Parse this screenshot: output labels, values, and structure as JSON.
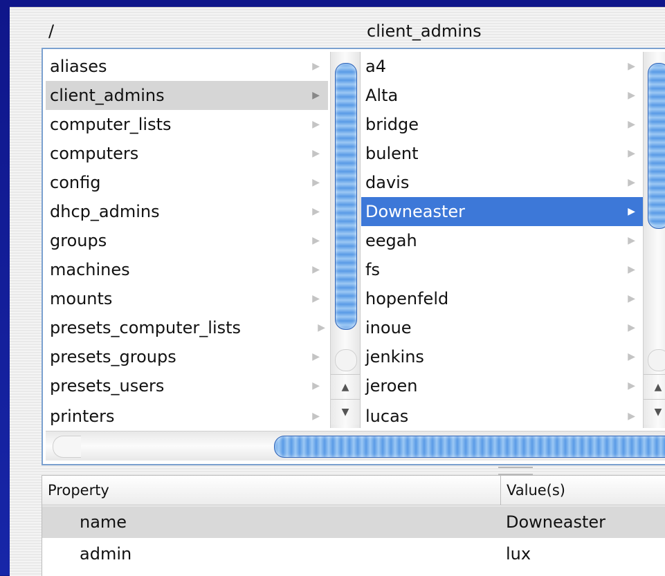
{
  "path_header": "/",
  "column_header": "client_admins",
  "column1": {
    "items": [
      {
        "label": "aliases"
      },
      {
        "label": "client_admins",
        "selected": "inactive"
      },
      {
        "label": "computer_lists"
      },
      {
        "label": "computers"
      },
      {
        "label": "config"
      },
      {
        "label": "dhcp_admins"
      },
      {
        "label": "groups"
      },
      {
        "label": "machines"
      },
      {
        "label": "mounts"
      },
      {
        "label": "presets_computer_lists"
      },
      {
        "label": "presets_groups"
      },
      {
        "label": "presets_users"
      },
      {
        "label": "printers"
      }
    ]
  },
  "column2": {
    "items": [
      {
        "label": "a4"
      },
      {
        "label": "Alta"
      },
      {
        "label": "bridge"
      },
      {
        "label": "bulent"
      },
      {
        "label": "davis"
      },
      {
        "label": "Downeaster",
        "selected": "active"
      },
      {
        "label": "eegah"
      },
      {
        "label": "fs"
      },
      {
        "label": "hopenfeld"
      },
      {
        "label": "inoue"
      },
      {
        "label": "jenkins"
      },
      {
        "label": "jeroen"
      },
      {
        "label": "lucas"
      }
    ]
  },
  "icons": {
    "row_arrow": "▶",
    "scroll_up": "▲",
    "scroll_down": "▼"
  },
  "properties": {
    "headers": {
      "property": "Property",
      "values": "Value(s)"
    },
    "rows": [
      {
        "name": "name",
        "value": "Downeaster"
      },
      {
        "name": "admin",
        "value": "lux"
      }
    ]
  },
  "colors": {
    "slide_background": "#101a8c",
    "selection_active": "#3d78d8",
    "selection_inactive": "#d6d6d6",
    "scroll_thumb": "#5a9be6"
  }
}
